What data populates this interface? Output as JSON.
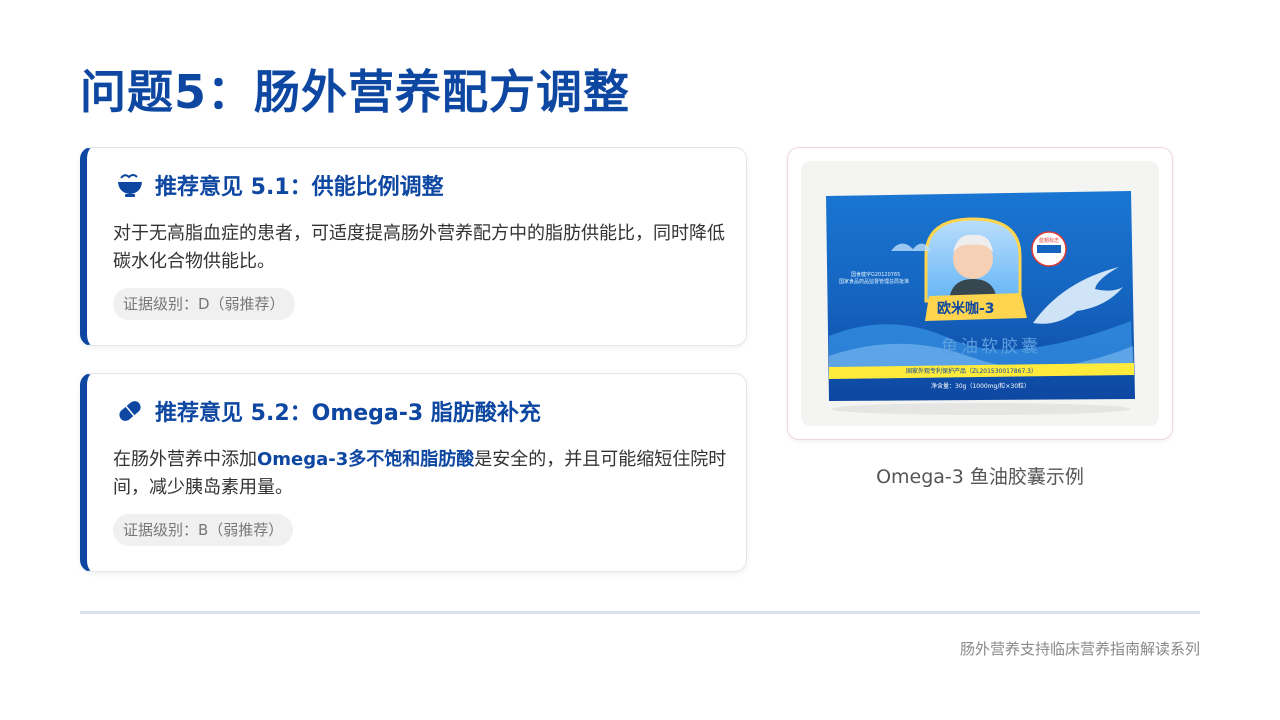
{
  "page": {
    "title": "问题5：肠外营养配方调整",
    "footer": "肠外营养支持临床营养指南解读系列"
  },
  "recommendations": [
    {
      "icon": "bowl-icon",
      "title": "推荐意见 5.1：供能比例调整",
      "body": "对于无高脂血症的患者，可适度提高肠外营养配方中的脂肪供能比，同时降低碳水化合物供能比。",
      "evidence": "证据级别：D（弱推荐）"
    },
    {
      "icon": "capsule-icon",
      "title": "推荐意见 5.2：Omega-3 脂肪酸补充",
      "body_before": "在肠外营养中添加",
      "body_highlight": "Omega-3多不饱和脂肪酸",
      "body_after": "是安全的，并且可能缩短住院时间，减少胰岛素用量。",
      "evidence": "证据级别：B（弱推荐）"
    }
  ],
  "figure": {
    "caption": "Omega-3 鱼油胶囊示例",
    "product": {
      "brand": "欧米咖-3",
      "name": "鱼油软胶囊",
      "patent": "国家外观专利保护产品（ZL201530017867.3）",
      "net_content": "净含量：30g（1000mg/粒×30粒）",
      "approval": "国食健字G20120765",
      "approval_sub": "国家食品药品监督管理总局批准",
      "seal": "蓝帽标志"
    }
  },
  "colors": {
    "accent": "#0d47a1",
    "box_blue": "#1565c0",
    "box_yellow": "#ffeb3b"
  }
}
